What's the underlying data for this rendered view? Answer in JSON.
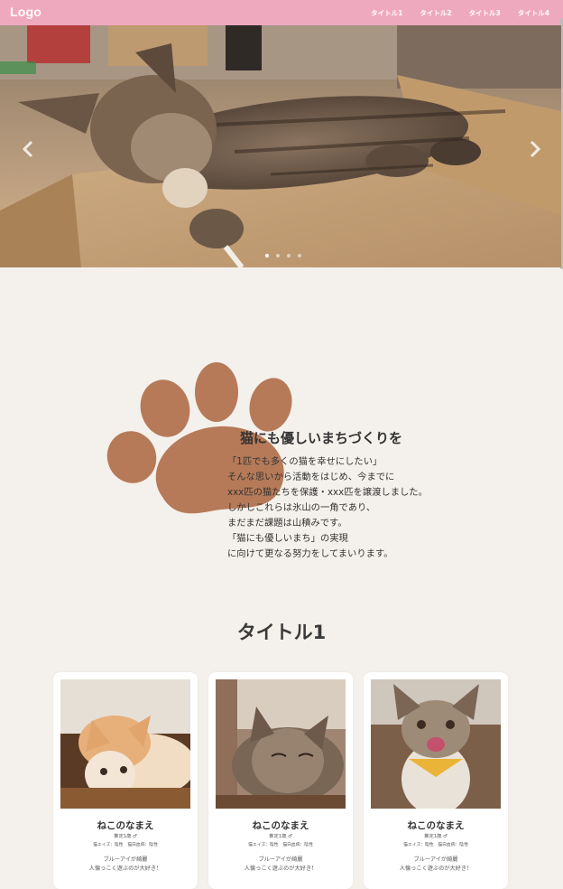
{
  "header": {
    "logo": "Logo",
    "nav": [
      "タイトル1",
      "タイトル2",
      "タイトル3",
      "タイトル4"
    ]
  },
  "hero": {
    "slide_count": 4,
    "active_slide": 1,
    "image": "tabby-cat-sleeping-on-cardboard-scratcher"
  },
  "intro": {
    "title": "猫にも優しいまちづくりを",
    "lines": [
      "「1匹でも多くの猫を幸せにしたい」",
      "そんな思いから活動をはじめ、今までに",
      "xxx匹の猫たちを保護・xxx匹を譲渡しました。",
      "しかしこれらは氷山の一角であり、",
      "まだまだ課題は山積みです。",
      "「猫にも優しいまち」の実現",
      "に向けて更なる努力をしてまいります。"
    ]
  },
  "section1": {
    "title": "タイトル1"
  },
  "cards": [
    {
      "name": "ねこのなまえ",
      "age": "推定1歳 ♂",
      "tags": "猫エイズ：陰性　猫白血病：陰性",
      "desc1": "ブルーアイが綺麗",
      "desc2": "人懐っこく遊ぶのが大好き！",
      "photo": "orange-white-kitten"
    },
    {
      "name": "ねこのなまえ",
      "age": "推定1歳 ♂",
      "tags": "猫エイズ：陰性　猫白血病：陰性",
      "desc1": "ブルーアイが綺麗",
      "desc2": "人懐っこく遊ぶのが大好き！",
      "photo": "tabby-cat-lying"
    },
    {
      "name": "ねこのなまえ",
      "age": "推定1歳 ♂",
      "tags": "猫エイズ：陰性　猫白血病：陰性",
      "desc1": "ブルーアイが綺麗",
      "desc2": "人懐っこく遊ぶのが大好き！",
      "photo": "smiling-cat-yellow-bandana"
    }
  ],
  "colors": {
    "header": "#efa9bf",
    "background": "#f4f1ec",
    "paw": "#b67a58",
    "card": "#ffffff"
  },
  "icons": {
    "prev": "chevron-left-icon",
    "next": "chevron-right-icon",
    "paw": "paw-icon"
  }
}
